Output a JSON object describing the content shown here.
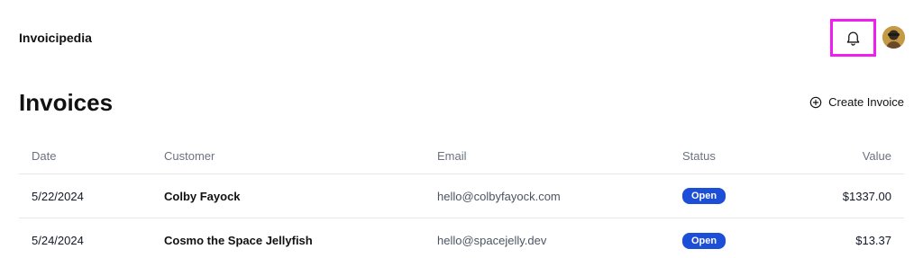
{
  "header": {
    "brand": "Invoicipedia",
    "notifications_icon": "bell-icon",
    "avatar_icon": "user-avatar"
  },
  "page": {
    "title": "Invoices",
    "create_label": "Create Invoice",
    "create_icon": "plus-circle-icon"
  },
  "table": {
    "columns": [
      "Date",
      "Customer",
      "Email",
      "Status",
      "Value"
    ],
    "rows": [
      {
        "date": "5/22/2024",
        "customer": "Colby Fayock",
        "email": "hello@colbyfayock.com",
        "status": "Open",
        "value": "$1337.00"
      },
      {
        "date": "5/24/2024",
        "customer": "Cosmo the Space Jellyfish",
        "email": "hello@spacejelly.dev",
        "status": "Open",
        "value": "$13.37"
      }
    ]
  },
  "colors": {
    "highlight": "#f01ef0",
    "badge": "#1d4ed8"
  }
}
